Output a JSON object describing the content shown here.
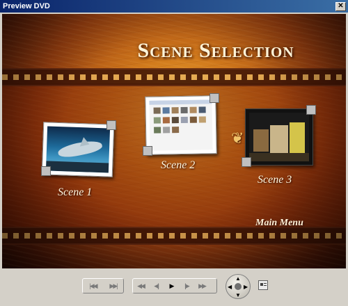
{
  "window": {
    "title": "Preview DVD",
    "close_glyph": "✕"
  },
  "menu": {
    "heading": "Scene Selection",
    "scenes": [
      {
        "label": "Scene 1",
        "thumbnail": "shark-underwater"
      },
      {
        "label": "Scene 2",
        "thumbnail": "photo-gallery-screenshot"
      },
      {
        "label": "Scene 3",
        "thumbnail": "books-on-desk"
      }
    ],
    "main_menu_label": "Main Menu",
    "selection_icon": "ornament-pointer-icon"
  },
  "controls": {
    "chapter_group": [
      "previous-chapter-icon",
      "next-chapter-icon"
    ],
    "transport_group": [
      "rewind-icon",
      "step-back-icon",
      "play-icon",
      "step-forward-icon",
      "fast-forward-icon"
    ],
    "glyphs": {
      "prev_chapter": "|◀◀",
      "next_chapter": "▶▶|",
      "rewind": "◀◀",
      "step_back": "◀||",
      "play": "▶",
      "step_forward": "||▶",
      "fast_forward": "▶▶",
      "nav_up": "▲",
      "nav_down": "▼",
      "nav_left": "◀",
      "nav_right": "▶"
    },
    "navigation_pad": "dvd-navigation-pad-icon",
    "menu_button": "dvd-menu-icon"
  },
  "colors": {
    "titlebar_start": "#0a246a",
    "titlebar_end": "#3a6ea5",
    "menu_background": "#d0781b",
    "text_cream": "#fff4d8"
  }
}
